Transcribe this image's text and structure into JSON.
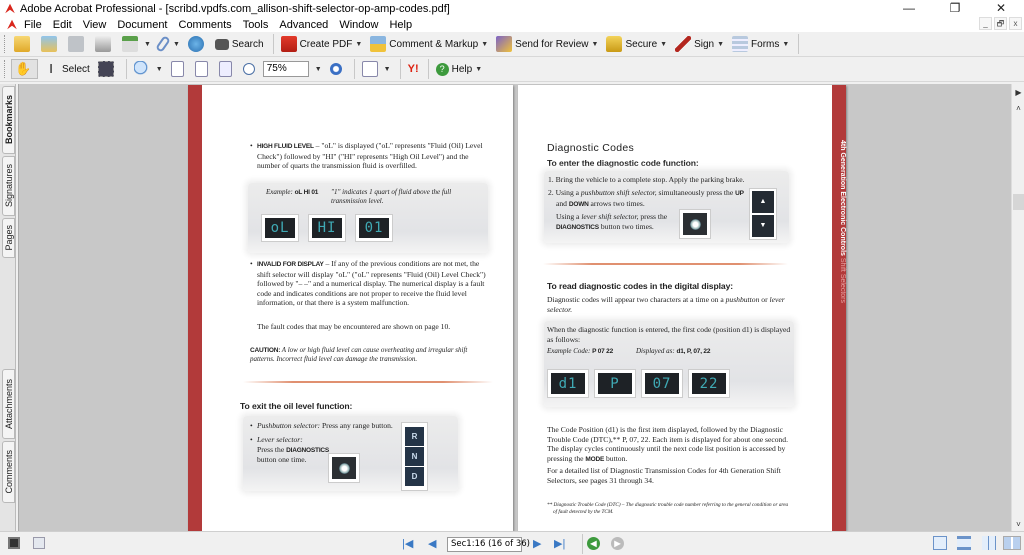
{
  "window": {
    "title": "Adobe Acrobat Professional - [scribd.vpdfs.com_allison-shift-selector-op-amp-codes.pdf]",
    "controls": {
      "minimize": "—",
      "restore": "❐",
      "close": "✕"
    },
    "mdi_controls": {
      "minimize": "_",
      "restore": "🗗",
      "close": "x"
    }
  },
  "menubar": {
    "items": [
      "File",
      "Edit",
      "View",
      "Document",
      "Comments",
      "Tools",
      "Advanced",
      "Window",
      "Help"
    ]
  },
  "toolbar1": {
    "search_label": "Search",
    "create_pdf_label": "Create PDF",
    "comment_markup_label": "Comment & Markup",
    "send_review_label": "Send for Review",
    "secure_label": "Secure",
    "sign_label": "Sign",
    "forms_label": "Forms"
  },
  "toolbar2": {
    "select_label": "Select",
    "zoom_value": "75%",
    "help_label": "Help",
    "yahoo_label": "Y!"
  },
  "nav_tabs": {
    "top": [
      "Bookmarks",
      "Signatures",
      "Pages"
    ],
    "bottom": [
      "Attachments",
      "Comments"
    ]
  },
  "left_page": {
    "high_fluid": {
      "title": "HIGH FLUID LEVEL",
      "text_a": " – \"oL\" is displayed (\"oL\" represents \"Fluid (Oil) Level Check\") followed by \"HI\" (\"HI\" represents \"High Oil Level\") and the number of quarts the transmission fluid is overfilled.",
      "example_label": "Example:",
      "example_value": "oL HI 01",
      "example_note": "\"1\" indicates 1 quart of fluid above the full transmission level.",
      "displays": [
        "oL",
        "HI",
        "01"
      ]
    },
    "invalid": {
      "title": "INVALID FOR DISPLAY",
      "text": " – If any of the previous conditions are not met, the shift selector will display \"oL\" (\"oL\" represents \"Fluid (Oil) Level Check\") followed by \"– –\" and a numerical display. The numerical display is a fault code and indicates conditions are not proper to receive the fluid level information, or that there is a system malfunction.",
      "fault_codes": "The fault codes that may be encountered are shown on page 10."
    },
    "caution": {
      "label": "CAUTION:",
      "text": " A low or high fluid level can cause overheating and irregular shift patterns. Incorrect fluid level can damage the transmission."
    },
    "exit": {
      "heading": "To exit the oil level function:",
      "pushbutton_label": "Pushbutton selector:",
      "pushbutton_text": " Press any range button.",
      "lever_label": "Lever selector:",
      "lever_text_a": "Press the ",
      "lever_text_b": "DIAGNOSTICS",
      "lever_text_c": " button one time.",
      "range_buttons": [
        "R",
        "N",
        "D"
      ]
    }
  },
  "right_page": {
    "title": "Diagnostic Codes",
    "enter": {
      "heading": "To enter the diagnostic code function:",
      "step1": "1. Bring the vehicle to a complete stop. Apply the parking brake.",
      "step2_a": "2. Using a ",
      "step2_b": "pushbutton shift selector,",
      "step2_c": " simultaneously press the ",
      "step2_d": "UP",
      "step2_e": " and ",
      "step2_f": "DOWN",
      "step2_g": " arrows two times.",
      "lever_a": "Using a ",
      "lever_b": "lever shift selector,",
      "lever_c": " press the ",
      "lever_d": "DIAGNOSTICS",
      "lever_e": " button two times."
    },
    "read": {
      "heading": "To read diagnostic codes in the digital display:",
      "intro_a": "Diagnostic codes will appear two characters at a time on a ",
      "intro_b": "pushbutton",
      "intro_c": " or ",
      "intro_d": "lever selector.",
      "entered": "When the diagnostic function is entered, the first code (position d1) is displayed as follows:",
      "example_label": "Example Code:",
      "example_value": "P 07 22",
      "displayed_label": "Displayed as:",
      "displayed_value": "d1, P, 07, 22",
      "displays": [
        "d1",
        "P",
        "07",
        "22"
      ]
    },
    "code_position": "The Code Position (d1) is the first item displayed, followed by the Diagnostic Trouble Code (DTC),** P, 07, 22. Each item is displayed for about one second. The display cycles continuously until the next code list position is accessed by pressing the ",
    "mode_label": "MODE",
    "code_position_end": " button.",
    "detailed_list": "For a detailed list of Diagnostic Transmission Codes for 4th Generation Shift Selectors, see pages 31 through 34.",
    "footnote_a": "** Diagnostic Trouble Code (DTC) –",
    "footnote_b": " The diagnostic trouble code number referring to the general condition or area of fault detected by the TCM.",
    "side_tab_bold": "4th Generation Electronic Controls",
    "side_tab_light": " Shift Selectors"
  },
  "statusbar": {
    "page_indicator": "Sec1:16  (16 of 36)"
  }
}
